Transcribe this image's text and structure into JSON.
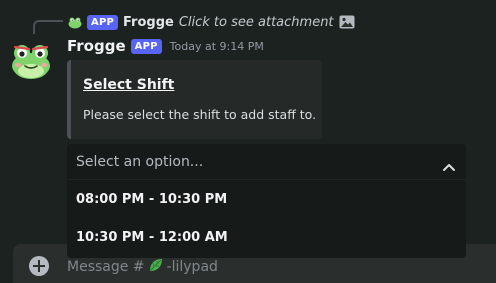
{
  "reply": {
    "tag": "APP",
    "author": "Frogge",
    "text": "Click to see attachment"
  },
  "message": {
    "author": "Frogge",
    "tag": "APP",
    "timestamp": "Today at 9:14 PM"
  },
  "embed": {
    "title": "Select Shift",
    "description": "Please select the shift to add staff to."
  },
  "select": {
    "placeholder": "Select an option...",
    "options": [
      "08:00 PM - 10:30 PM",
      "10:30 PM - 12:00 AM"
    ]
  },
  "composer": {
    "prefix": "Message #",
    "channel": "-lilypad"
  },
  "colors": {
    "app_tag": "#5865f2",
    "background": "#1c2220",
    "dropdown": "#161b19"
  },
  "icons": {
    "reply_attachment": "image-icon",
    "chevron": "chevron-up-icon",
    "composer_add": "plus-circle-icon",
    "channel_emoji": "leaf-icon"
  }
}
